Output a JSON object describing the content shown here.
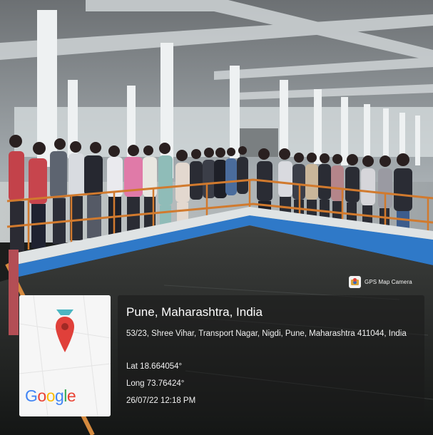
{
  "overlay": {
    "app_badge": "GPS Map Camera",
    "map_logo": "Google",
    "location_title": "Pune, Maharashtra, India",
    "address": "53/23, Shree Vihar, Transport Nagar, Nigdi, Pune, Maharashtra 411044, India",
    "latitude": "Lat 18.664054°",
    "longitude": "Long 73.76424°",
    "timestamp": "26/07/22 12:18 PM"
  },
  "colors": {
    "pin_red": "#e0403a",
    "pin_teal": "#4bb6c2",
    "railing_orange": "#d17a2e",
    "tank_blue": "#2f79c8",
    "google_blue": "#4285f4",
    "google_red": "#ea4335",
    "google_yellow": "#fbbc05",
    "google_green": "#34a853"
  },
  "icons": {
    "gps_badge": "camera-pin-icon",
    "map_pin": "map-pin-icon"
  }
}
